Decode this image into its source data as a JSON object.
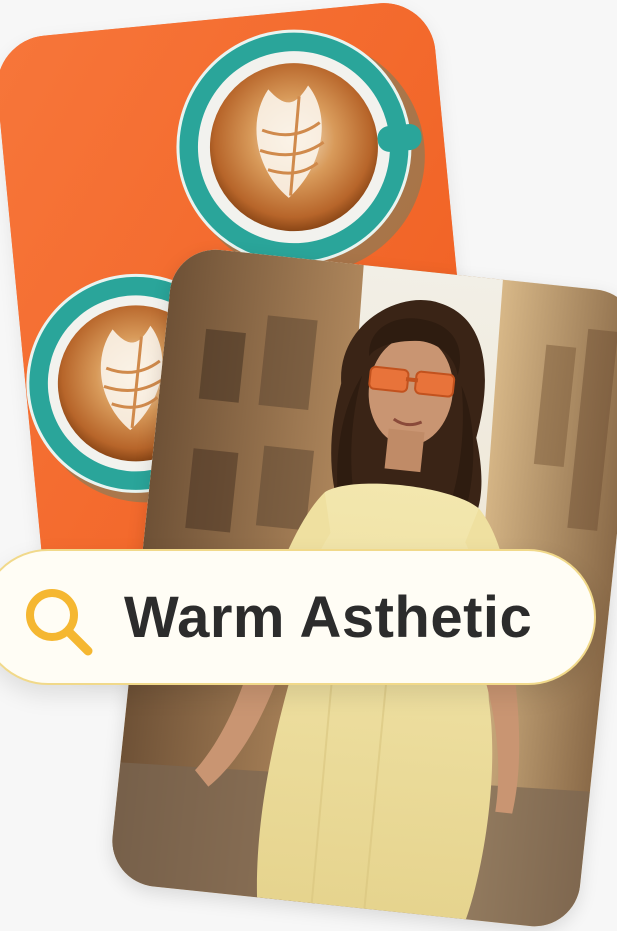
{
  "search": {
    "query": "Warm Asthetic",
    "icon": "search-icon"
  },
  "cards": [
    {
      "subject": "latte-art-coffee-cups",
      "background": "#f46a2a"
    },
    {
      "subject": "woman-with-orange-sunglasses-street",
      "background": "#c9a77c"
    }
  ],
  "colors": {
    "accent": "#f5b731",
    "orange": "#f46a2a",
    "teal": "#2aa59a",
    "text": "#2c2c2c"
  }
}
